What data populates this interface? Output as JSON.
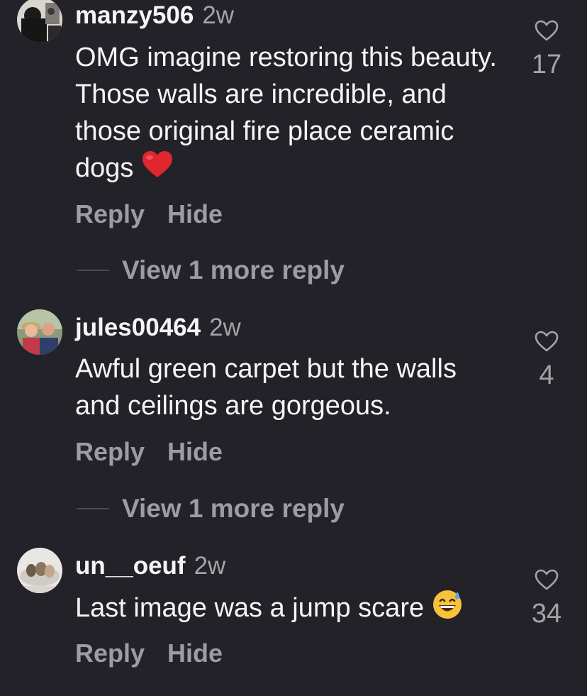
{
  "comments": [
    {
      "username": "manzy506",
      "time": "2w",
      "text": "OMG imagine restoring this beauty. Those walls are incredible, and those original fire place ceramic dogs",
      "emoji": "red-heart",
      "reply_label": "Reply",
      "hide_label": "Hide",
      "like_count": "17",
      "view_more": "View 1 more reply"
    },
    {
      "username": "jules00464",
      "time": "2w",
      "text": "Awful green carpet but the walls and ceilings are gorgeous.",
      "reply_label": "Reply",
      "hide_label": "Hide",
      "like_count": "4",
      "view_more": "View 1 more reply"
    },
    {
      "username": "un__oeuf",
      "time": "2w",
      "text": "Last image was a jump scare",
      "emoji": "grinning-sweat-face",
      "reply_label": "Reply",
      "hide_label": "Hide",
      "like_count": "34"
    }
  ],
  "colors": {
    "background": "#222228",
    "text": "#f5f5f5",
    "secondary": "#9c9ca2",
    "heart_emoji": "#e0262f"
  },
  "icons": {
    "like": "heart-outline-icon"
  }
}
